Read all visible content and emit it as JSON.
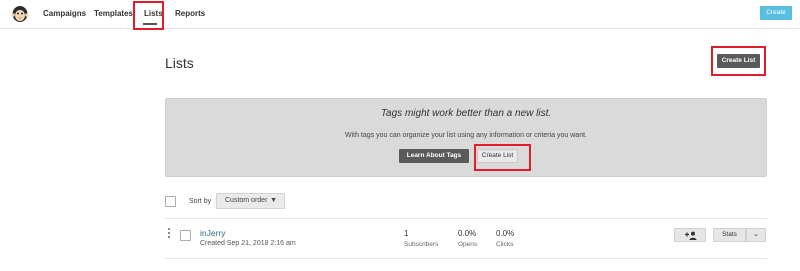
{
  "nav": {
    "items": [
      "Campaigns",
      "Templates",
      "Lists",
      "Reports"
    ],
    "active": "Lists",
    "create_label": "Create"
  },
  "page": {
    "title": "Lists",
    "create_list_label": "Create List"
  },
  "banner": {
    "title": "Tags might work better than a new list.",
    "text": "With tags you can organize your list using any information or criteria you want.",
    "learn_label": "Learn About Tags",
    "create_label": "Create List"
  },
  "sort": {
    "label": "Sort by",
    "selected": "Custom order"
  },
  "lists": [
    {
      "name": "inJerry",
      "created": "Created Sep 21, 2018 2:16 am",
      "subscribers_value": "1",
      "subscribers_label": "Subscribers",
      "opens_value": "0.0%",
      "opens_label": "Opens",
      "clicks_value": "0.0%",
      "clicks_label": "Clicks",
      "stats_label": "Stats"
    }
  ],
  "colors": {
    "accent": "#58bfe0",
    "dark_button": "#5a5a5a",
    "highlight": "#e01e2b",
    "link": "#2c6f87"
  },
  "icons": [
    "mailchimp-logo",
    "add-subscriber-icon",
    "chevron-down-icon",
    "kebab-menu-icon"
  ]
}
